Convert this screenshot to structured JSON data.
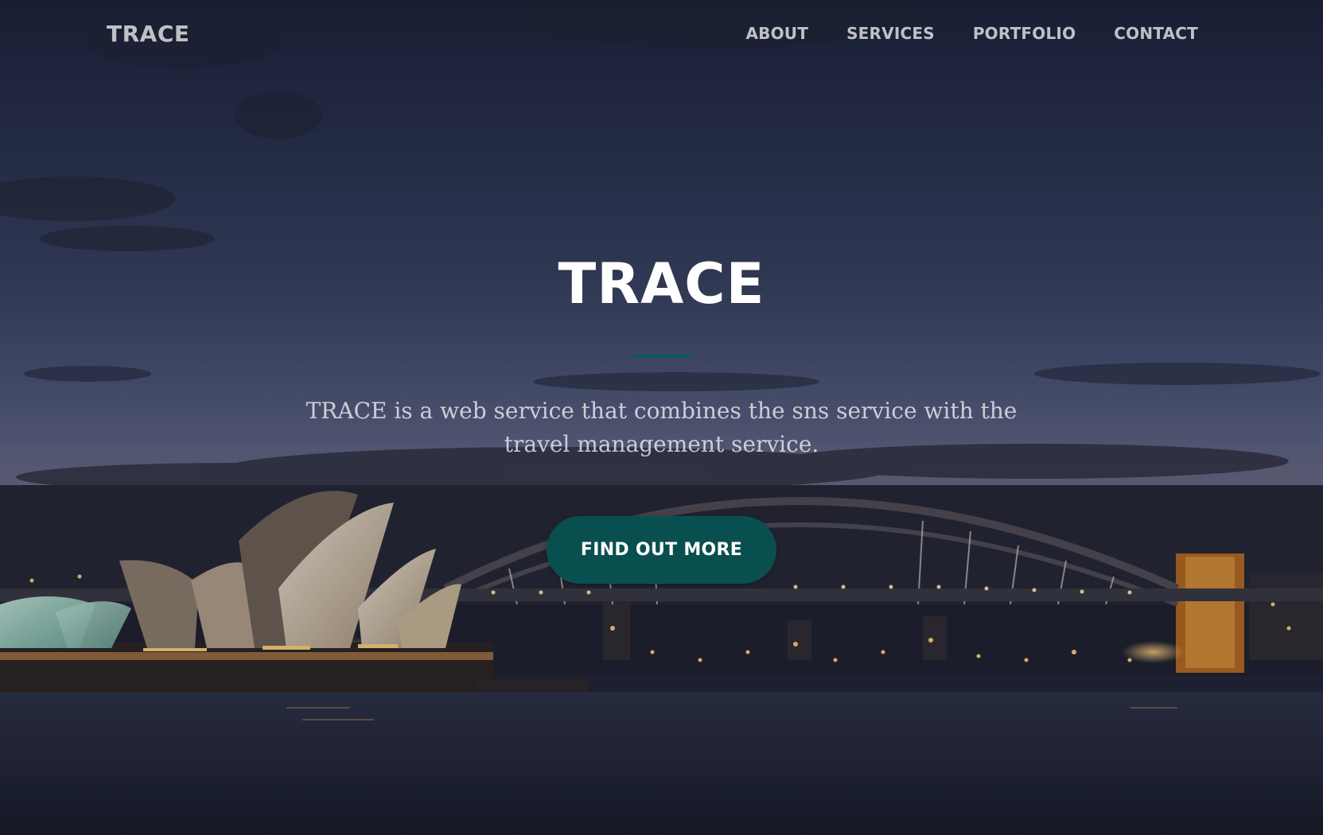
{
  "navbar": {
    "brand": "TRACE",
    "links": [
      {
        "label": "ABOUT"
      },
      {
        "label": "SERVICES"
      },
      {
        "label": "PORTFOLIO"
      },
      {
        "label": "CONTACT"
      }
    ]
  },
  "hero": {
    "title": "TRACE",
    "subtitle": "TRACE is a web service that combines the sns service with the travel management service.",
    "cta_label": "FIND OUT MORE"
  },
  "colors": {
    "accent": "#0a4f50",
    "divider": "#0b5a5a"
  }
}
